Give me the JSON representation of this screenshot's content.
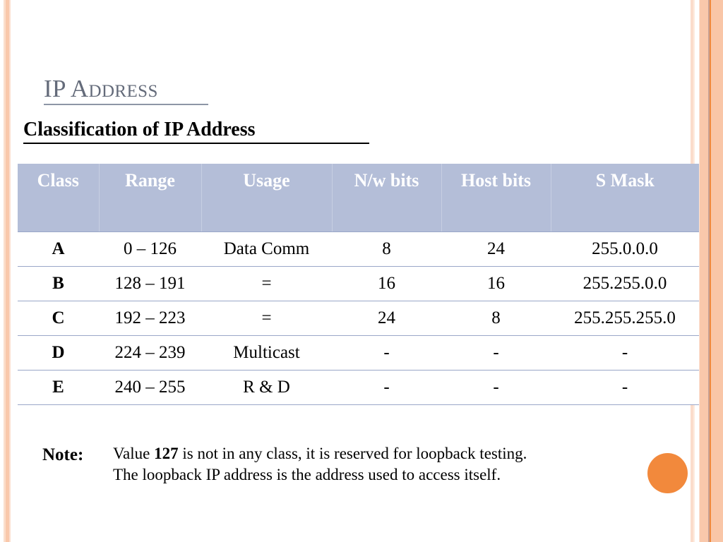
{
  "slide": {
    "title": "IP Address",
    "subtitle": "Classification of IP Address",
    "accent_color": "#f2893c",
    "header_fill": "#b4bed8",
    "title_color": "#646b7a",
    "grid_line_color": "#9aa7c8"
  },
  "table": {
    "columns": [
      "Class",
      "Range",
      "Usage",
      "N/w bits",
      "Host bits",
      "S Mask"
    ],
    "rows": [
      {
        "class": "A",
        "range": "0 – 126",
        "usage": "Data Comm",
        "nw_bits": "8",
        "host_bits": "24",
        "s_mask": "255.0.0.0"
      },
      {
        "class": "B",
        "range": "128 – 191",
        "usage": "=",
        "nw_bits": "16",
        "host_bits": "16",
        "s_mask": "255.255.0.0"
      },
      {
        "class": "C",
        "range": "192 – 223",
        "usage": "=",
        "nw_bits": "24",
        "host_bits": "8",
        "s_mask": "255.255.255.0"
      },
      {
        "class": "D",
        "range": "224 – 239",
        "usage": "Multicast",
        "nw_bits": "-",
        "host_bits": "-",
        "s_mask": "-"
      },
      {
        "class": "E",
        "range": "240 – 255",
        "usage": "R & D",
        "nw_bits": "-",
        "host_bits": "-",
        "s_mask": "-"
      }
    ]
  },
  "note": {
    "label": "Note:",
    "line1_before": "Value ",
    "line1_bold": "127",
    "line1_after": " is not in any class, it is reserved for loopback testing.",
    "line2": "The loopback IP address is the address used to access itself."
  }
}
